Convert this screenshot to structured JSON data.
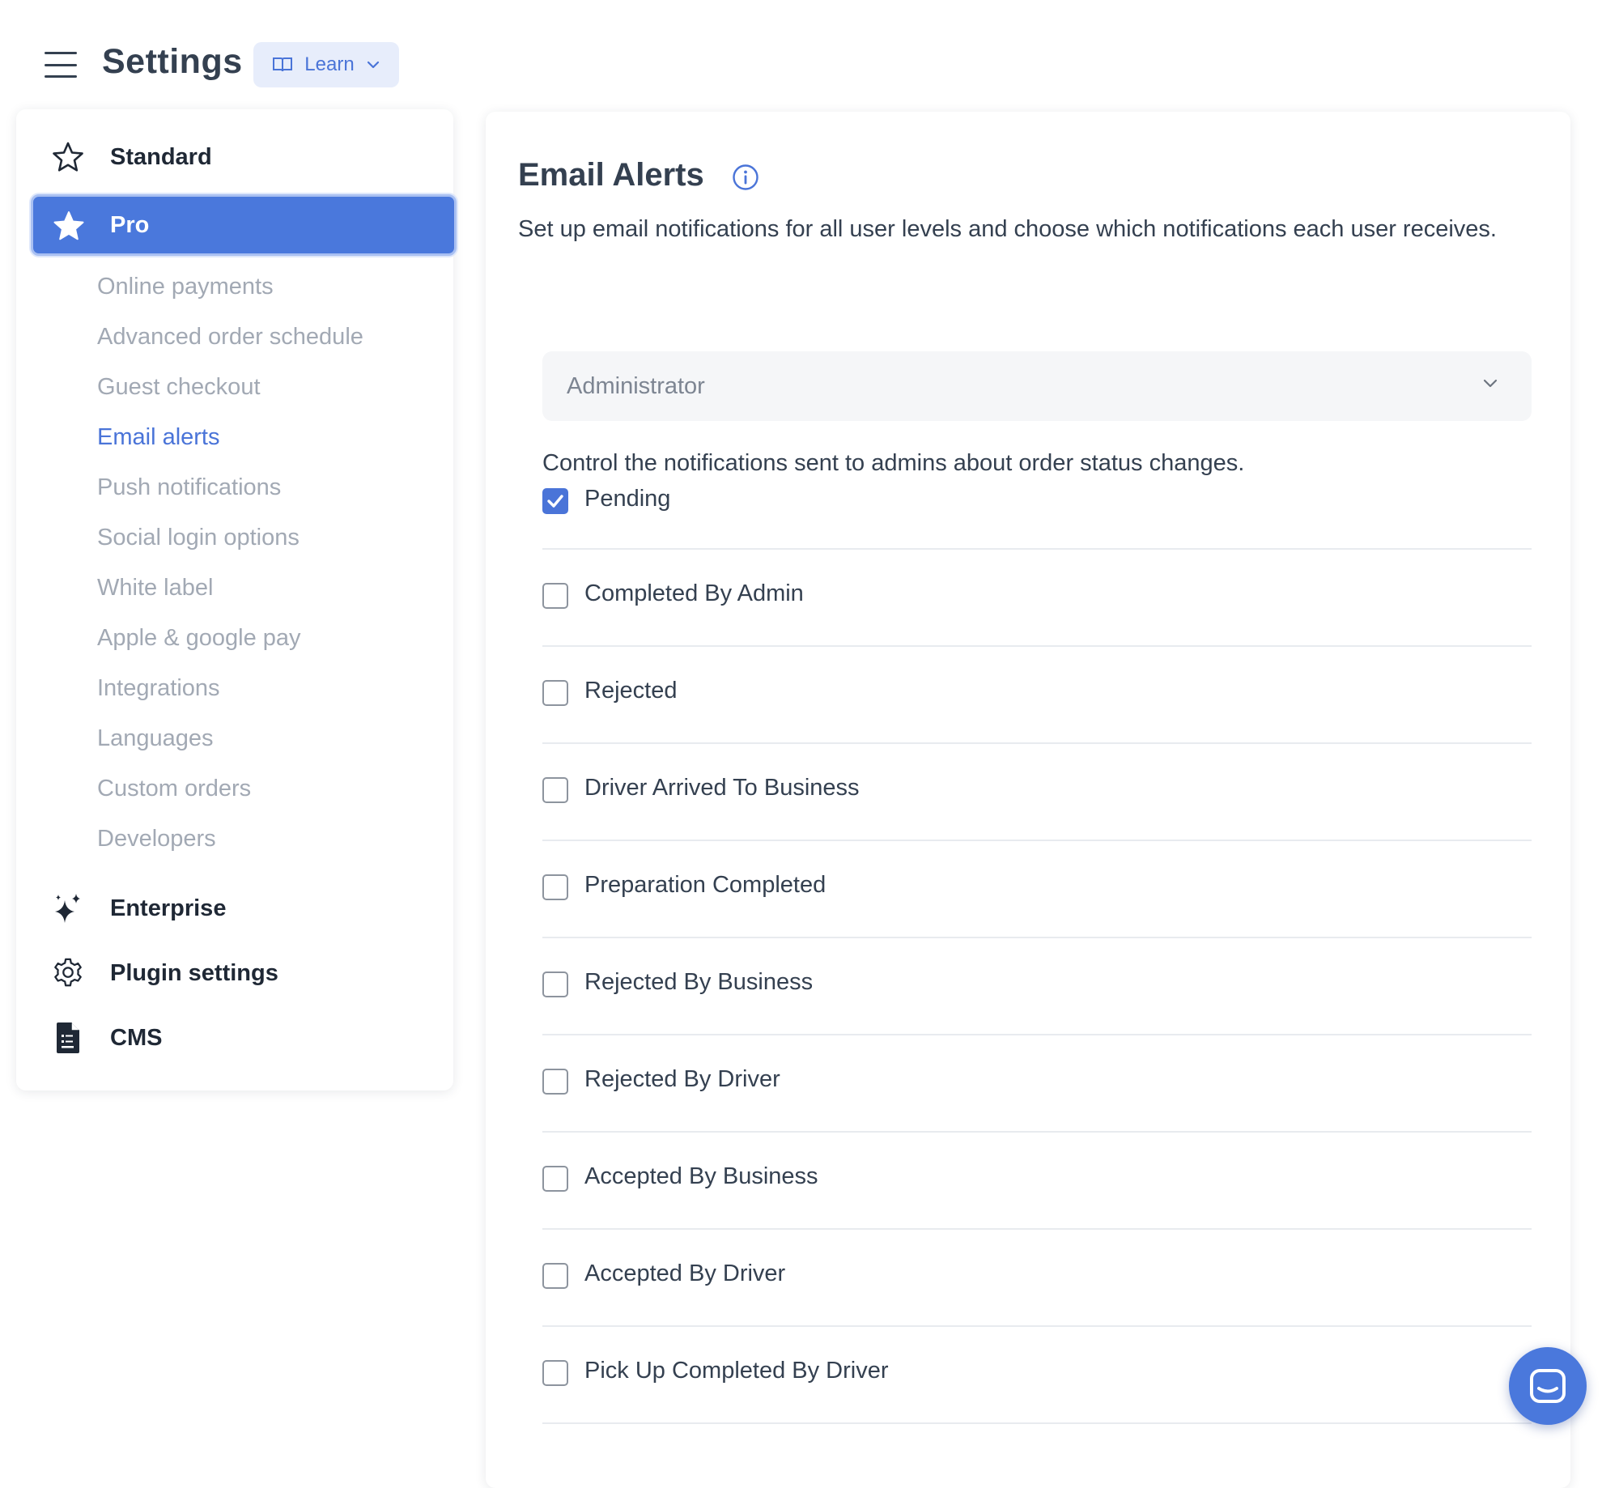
{
  "header": {
    "title": "Settings",
    "learn_label": "Learn"
  },
  "sidebar": {
    "standard_label": "Standard",
    "pro_label": "Pro",
    "pro_items": [
      {
        "label": "Online payments"
      },
      {
        "label": "Advanced order schedule"
      },
      {
        "label": "Guest checkout"
      },
      {
        "label": "Email alerts"
      },
      {
        "label": "Push notifications"
      },
      {
        "label": "Social login options"
      },
      {
        "label": "White label"
      },
      {
        "label": "Apple & google pay"
      },
      {
        "label": "Integrations"
      },
      {
        "label": "Languages"
      },
      {
        "label": "Custom orders"
      },
      {
        "label": "Developers"
      }
    ],
    "active_item": "Email alerts",
    "enterprise_label": "Enterprise",
    "plugin_settings_label": "Plugin settings",
    "cms_label": "CMS"
  },
  "main": {
    "title": "Email Alerts",
    "description": "Set up email notifications for all user levels and choose which notifications each user receives.",
    "role_select": {
      "selected": "Administrator"
    },
    "control_text": "Control the notifications sent to admins about order status changes.",
    "statuses": [
      {
        "label": "Pending",
        "checked": true
      },
      {
        "label": "Completed By Admin",
        "checked": false
      },
      {
        "label": "Rejected",
        "checked": false
      },
      {
        "label": "Driver Arrived To Business",
        "checked": false
      },
      {
        "label": "Preparation Completed",
        "checked": false
      },
      {
        "label": "Rejected By Business",
        "checked": false
      },
      {
        "label": "Rejected By Driver",
        "checked": false
      },
      {
        "label": "Accepted By Business",
        "checked": false
      },
      {
        "label": "Accepted By Driver",
        "checked": false
      },
      {
        "label": "Pick Up Completed By Driver",
        "checked": false
      }
    ]
  },
  "colors": {
    "accent": "#4a78dc",
    "active_link": "#4a74d8",
    "muted_text": "#a2a9b4",
    "text": "#344050"
  },
  "icons": {
    "menu": "hamburger-icon",
    "learn": "book-icon",
    "standard": "star-outline-icon",
    "pro": "star-filled-icon",
    "enterprise": "sparkles-icon",
    "plugin": "gear-icon",
    "cms": "document-icon",
    "info": "info-icon",
    "chat": "chat-icon"
  }
}
